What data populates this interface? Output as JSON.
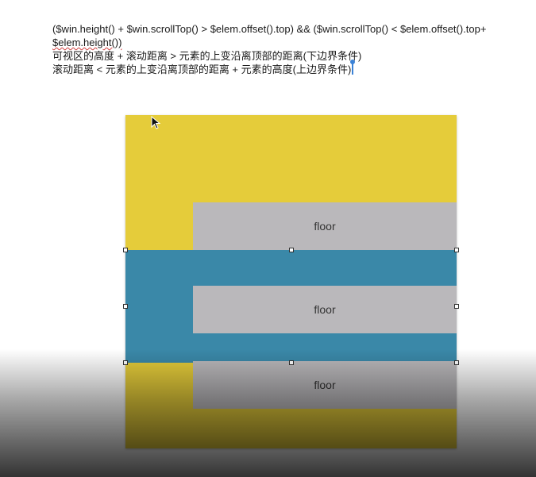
{
  "notes": {
    "line1": "($win.height() + $win.scrollTop() > $elem.offset().top) && ($win.scrollTop() < $elem.offset().top+",
    "line2": "$elem.height())",
    "line3": "可视区的高度 + 滚动距离 > 元素的上变沿离顶部的距离(下边界条件)",
    "line4": "滚动距离 < 元素的上变沿离顶部的距离 + 元素的高度(上边界条件)"
  },
  "floors": [
    "floor",
    "floor",
    "floor"
  ],
  "colors": {
    "page": "#e5cc3a",
    "viewport": "#3a88a8",
    "floor": "#bab8bb"
  }
}
